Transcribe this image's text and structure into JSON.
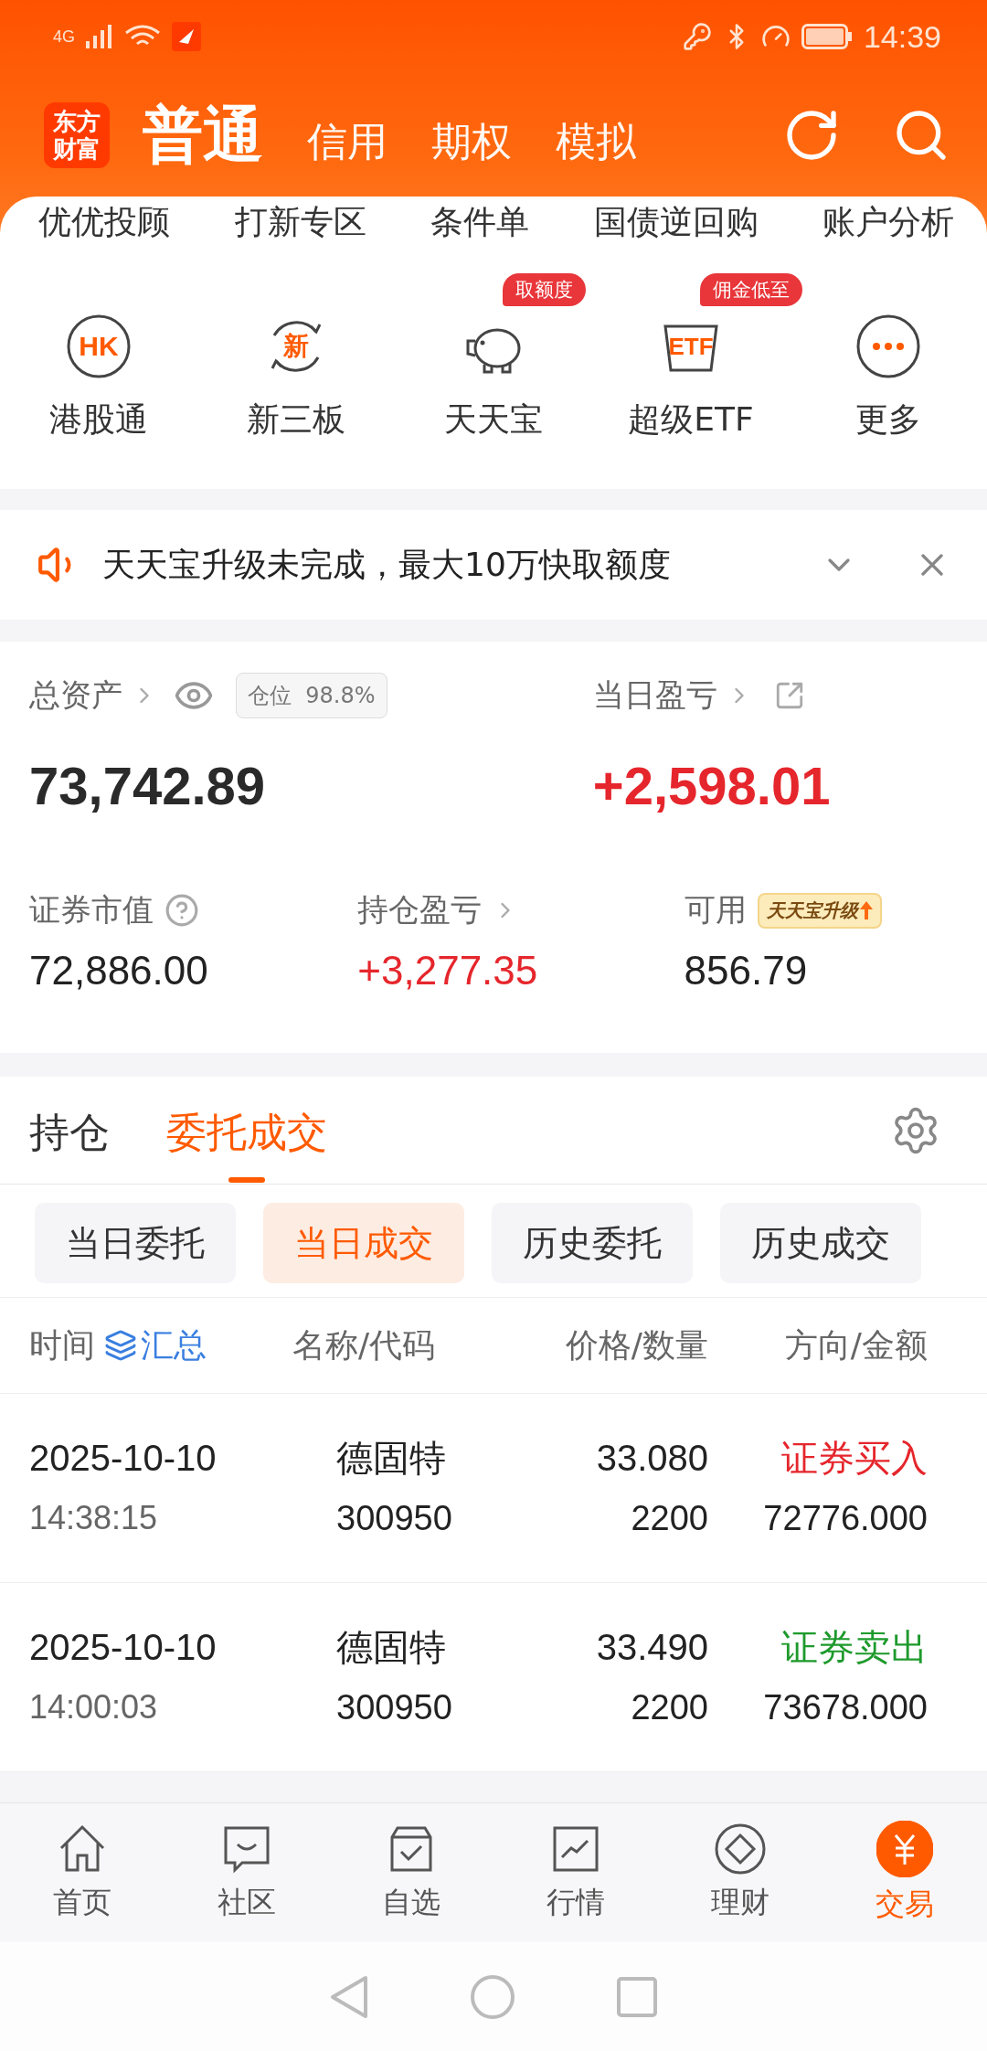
{
  "status_bar": {
    "network": "4G",
    "time": "14:39"
  },
  "header": {
    "logo": [
      "东方",
      "财富"
    ],
    "tabs": [
      {
        "label": "普通",
        "selected": true
      },
      {
        "label": "信用",
        "selected": false
      },
      {
        "label": "期权",
        "selected": false
      },
      {
        "label": "模拟",
        "selected": false
      }
    ]
  },
  "shortcuts": [
    "优优投顾",
    "打新专区",
    "条件单",
    "国债逆回购",
    "账户分析"
  ],
  "features": [
    {
      "label": "港股通",
      "kind": "hk",
      "icon_text": "HK"
    },
    {
      "label": "新三板",
      "kind": "new",
      "icon_text": "新"
    },
    {
      "label": "天天宝",
      "kind": "piggy",
      "badge": "取额度"
    },
    {
      "label": "超级ETF",
      "kind": "etf",
      "icon_text": "ETF",
      "badge": "佣金低至"
    },
    {
      "label": "更多",
      "kind": "more"
    }
  ],
  "notice": {
    "text": "天天宝升级未完成，最大10万快取额度"
  },
  "assets": {
    "total_label": "总资产",
    "position_label": "仓位",
    "position_value": "98.8%",
    "total": "73,742.89",
    "daily_label": "当日盈亏",
    "daily": "+2,598.01",
    "metrics": [
      {
        "label": "证券市值",
        "kind": "help",
        "value": "72,886.00",
        "color": "#222222"
      },
      {
        "label": "持仓盈亏",
        "kind": "link",
        "value": "+3,277.35",
        "color": "#e5262c"
      },
      {
        "label": "可用",
        "kind": "badge",
        "badge": "天天宝升级",
        "value": "856.79",
        "color": "#222222"
      }
    ]
  },
  "orders": {
    "tabs": [
      {
        "label": "持仓",
        "selected": false
      },
      {
        "label": "委托成交",
        "selected": true
      }
    ],
    "filters": [
      {
        "label": "当日委托",
        "selected": false
      },
      {
        "label": "当日成交",
        "selected": true
      },
      {
        "label": "历史委托",
        "selected": false
      },
      {
        "label": "历史成交",
        "selected": false
      }
    ],
    "columns": [
      "时间",
      "名称/代码",
      "价格/数量",
      "方向/金额"
    ],
    "summary": "汇总",
    "rows": [
      {
        "date": "2025-10-10",
        "time": "14:38:15",
        "name": "德固特",
        "code": "300950",
        "price": "33.080",
        "quantity": "2200",
        "direction": "证券买入",
        "amount": "72776.000",
        "color": "#e5262c"
      },
      {
        "date": "2025-10-10",
        "time": "14:00:03",
        "name": "德固特",
        "code": "300950",
        "price": "33.490",
        "quantity": "2200",
        "direction": "证券卖出",
        "amount": "73678.000",
        "color": "#1e9a2c"
      }
    ]
  },
  "bottom_nav": [
    {
      "label": "首页",
      "kind": "home",
      "selected": false
    },
    {
      "label": "社区",
      "kind": "community",
      "selected": false
    },
    {
      "label": "自选",
      "kind": "watchlist",
      "selected": false
    },
    {
      "label": "行情",
      "kind": "market",
      "selected": false
    },
    {
      "label": "理财",
      "kind": "wealth",
      "selected": false
    },
    {
      "label": "交易",
      "kind": "trade",
      "selected": true
    }
  ]
}
